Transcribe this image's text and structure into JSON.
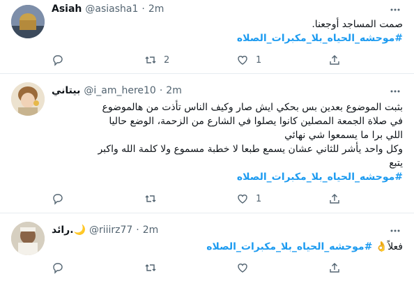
{
  "tweets": [
    {
      "name": "Asiah",
      "handle": "@asiasha1",
      "dot": "·",
      "time": "2m",
      "lines": [
        "صمت المساجد أوجعنا."
      ],
      "hashtag": "#موحشه_الحياه_بلا_مكبرات_الصلاه",
      "replies": "",
      "retweets": "2",
      "likes": "1"
    },
    {
      "name": "بيتاني",
      "handle": "@i_am_here10",
      "dot": "·",
      "time": "2m",
      "lines": [
        "بثبت الموضوع بعدين بس بحكي ايش صار وكيف الناس تأذت من هالموضوع",
        "في صلاة الجمعة المصلين كانوا يصلوا في الشارع من الزحمة، الوضع حاليا",
        "اللي برا ما يسمعوا شي نهائي",
        "وكل واحد يأشر للثاني عشان يسمع طبعا لا خطبة مسموع ولا كلمة الله واكبر",
        "يتبع"
      ],
      "hashtag": "#موحشه_الحياه_بلا_مكبرات_الصلاه",
      "replies": "",
      "retweets": "",
      "likes": "1"
    },
    {
      "name": "رائد.🌙",
      "handle": "@riiirz77",
      "dot": "·",
      "time": "2m",
      "lines": [],
      "prefix": "فعلاً👌",
      "hashtag": "#موحشه_الحياه_بلا_مكبرات_الصلاه",
      "replies": "",
      "retweets": "",
      "likes": ""
    }
  ],
  "icons": {
    "reply": "reply-icon",
    "retweet": "retweet-icon",
    "like": "heart-icon",
    "share": "share-icon",
    "more": "more-icon"
  },
  "colors": {
    "hashtag": "#1d9bf0",
    "muted": "#536471",
    "divider": "#e6ecf0"
  }
}
